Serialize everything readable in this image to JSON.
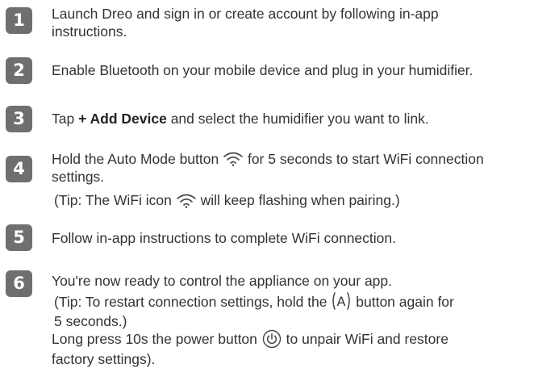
{
  "steps": [
    {
      "number": "1",
      "text": "Launch Dreo and sign in or create account by following in-app",
      "text_cont": "instructions."
    },
    {
      "number": "2",
      "text": "Enable Bluetooth on your mobile device and plug in your humidifier."
    },
    {
      "number": "3",
      "text_before": "Tap ",
      "bold": "+ Add Device",
      "text_after": " and select the humidifier you want to link."
    },
    {
      "number": "4",
      "text_before": "Hold the Auto Mode button ",
      "text_after": " for 5 seconds to start WiFi connection",
      "text_cont": "settings.",
      "tip_before": "(Tip: The WiFi icon ",
      "tip_after": " will keep flashing when pairing.)"
    },
    {
      "number": "5",
      "text": "Follow in-app instructions to complete WiFi connection."
    },
    {
      "number": "6",
      "text": "You're now ready to control the appliance on your app.",
      "tip_before": "(Tip: To restart connection settings, hold the ",
      "tip_after": " button again for",
      "tip_cont": "5 seconds.)",
      "long_before": "Long press 10s the power button ",
      "long_after": " to unpair WiFi and restore",
      "long_cont": "factory settings)."
    }
  ],
  "icons": {
    "wifi": "wifi-icon",
    "auto_mode": "auto-mode-icon",
    "power": "power-icon"
  },
  "auto_button_letter": "A",
  "colors": {
    "badge": "#6d6f71",
    "text": "#333333",
    "background": "#ffffff"
  }
}
